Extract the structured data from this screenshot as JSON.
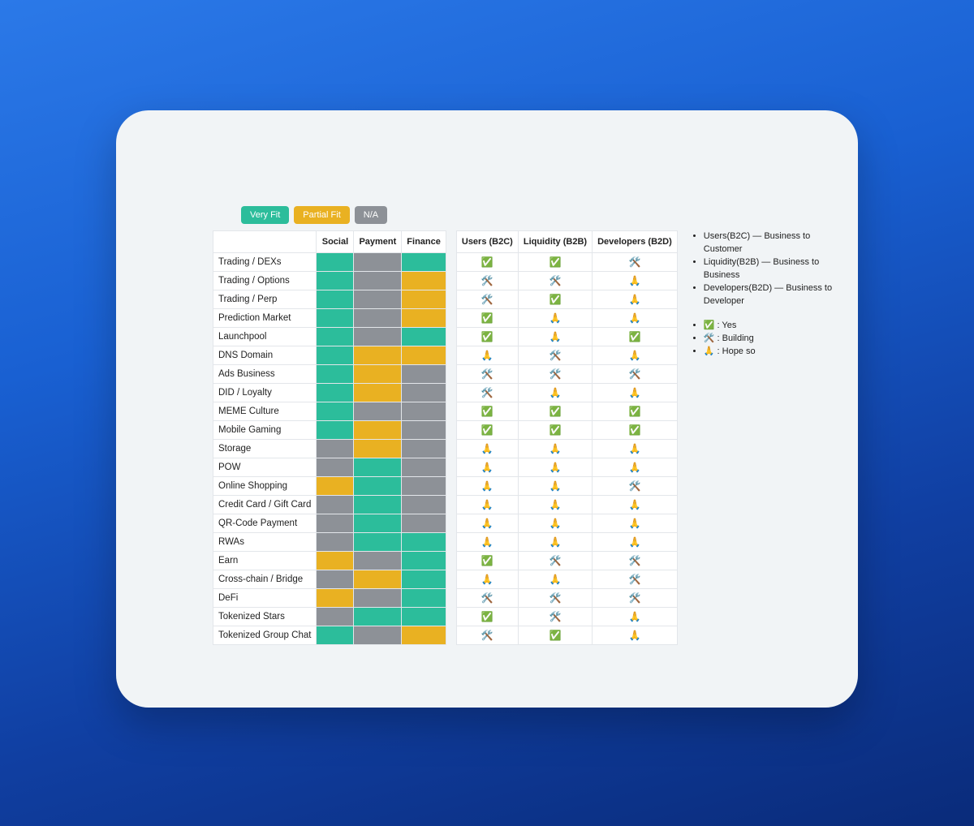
{
  "chart_data": {
    "type": "table",
    "title": "",
    "fit_legend": [
      "Very Fit",
      "Partial Fit",
      "N/A"
    ],
    "fit_columns": [
      "Social",
      "Payment",
      "Finance"
    ],
    "status_columns": [
      "Users (B2C)",
      "Liquidity (B2B)",
      "Developers (B2D)"
    ],
    "rows": [
      {
        "label": "Trading / DEXs",
        "fit": [
          "veryFit",
          "na",
          "veryFit"
        ],
        "status": [
          "yes",
          "yes",
          "building"
        ]
      },
      {
        "label": "Trading / Options",
        "fit": [
          "veryFit",
          "na",
          "partialFit"
        ],
        "status": [
          "building",
          "building",
          "hope"
        ]
      },
      {
        "label": "Trading / Perp",
        "fit": [
          "veryFit",
          "na",
          "partialFit"
        ],
        "status": [
          "building",
          "yes",
          "hope"
        ]
      },
      {
        "label": "Prediction Market",
        "fit": [
          "veryFit",
          "na",
          "partialFit"
        ],
        "status": [
          "yes",
          "hope",
          "hope"
        ]
      },
      {
        "label": "Launchpool",
        "fit": [
          "veryFit",
          "na",
          "veryFit"
        ],
        "status": [
          "yes",
          "hope",
          "yes"
        ]
      },
      {
        "label": "DNS Domain",
        "fit": [
          "veryFit",
          "partialFit",
          "partialFit"
        ],
        "status": [
          "hope",
          "building",
          "hope"
        ]
      },
      {
        "label": "Ads Business",
        "fit": [
          "veryFit",
          "partialFit",
          "na"
        ],
        "status": [
          "building",
          "building",
          "building"
        ]
      },
      {
        "label": "DID / Loyalty",
        "fit": [
          "veryFit",
          "partialFit",
          "na"
        ],
        "status": [
          "building",
          "hope",
          "hope"
        ]
      },
      {
        "label": "MEME Culture",
        "fit": [
          "veryFit",
          "na",
          "na"
        ],
        "status": [
          "yes",
          "yes",
          "yes"
        ]
      },
      {
        "label": "Mobile Gaming",
        "fit": [
          "veryFit",
          "partialFit",
          "na"
        ],
        "status": [
          "yes",
          "yes",
          "yes"
        ]
      },
      {
        "label": "Storage",
        "fit": [
          "na",
          "partialFit",
          "na"
        ],
        "status": [
          "hope",
          "hope",
          "hope"
        ]
      },
      {
        "label": "POW",
        "fit": [
          "na",
          "veryFit",
          "na"
        ],
        "status": [
          "hope",
          "hope",
          "hope"
        ]
      },
      {
        "label": "Online Shopping",
        "fit": [
          "partialFit",
          "veryFit",
          "na"
        ],
        "status": [
          "hope",
          "hope",
          "building"
        ]
      },
      {
        "label": "Credit Card / Gift Card",
        "fit": [
          "na",
          "veryFit",
          "na"
        ],
        "status": [
          "hope",
          "hope",
          "hope"
        ]
      },
      {
        "label": "QR-Code Payment",
        "fit": [
          "na",
          "veryFit",
          "na"
        ],
        "status": [
          "hope",
          "hope",
          "hope"
        ]
      },
      {
        "label": "RWAs",
        "fit": [
          "na",
          "veryFit",
          "veryFit"
        ],
        "status": [
          "hope",
          "hope",
          "hope"
        ]
      },
      {
        "label": "Earn",
        "fit": [
          "partialFit",
          "na",
          "veryFit"
        ],
        "status": [
          "yes",
          "building",
          "building"
        ]
      },
      {
        "label": "Cross-chain / Bridge",
        "fit": [
          "na",
          "partialFit",
          "veryFit"
        ],
        "status": [
          "hope",
          "hope",
          "building"
        ]
      },
      {
        "label": "DeFi",
        "fit": [
          "partialFit",
          "na",
          "veryFit"
        ],
        "status": [
          "building",
          "building",
          "building"
        ]
      },
      {
        "label": "Tokenized Stars",
        "fit": [
          "na",
          "veryFit",
          "veryFit"
        ],
        "status": [
          "yes",
          "building",
          "hope"
        ]
      },
      {
        "label": "Tokenized Group Chat",
        "fit": [
          "veryFit",
          "na",
          "partialFit"
        ],
        "status": [
          "building",
          "yes",
          "hope"
        ]
      }
    ],
    "status_icons": {
      "yes": "✅",
      "building": "🛠️",
      "hope": "🙏"
    },
    "audience_legend": [
      "Users(B2C) — Business to Customer",
      "Liquidity(B2B) — Business to Business",
      "Developers(B2D) — Business to Developer"
    ],
    "icon_legend": [
      "✅ : Yes",
      "🛠️ : Building",
      "🙏 : Hope so"
    ]
  },
  "chips": {
    "very": "Very Fit",
    "partial": "Partial Fit",
    "na": "N/A"
  }
}
